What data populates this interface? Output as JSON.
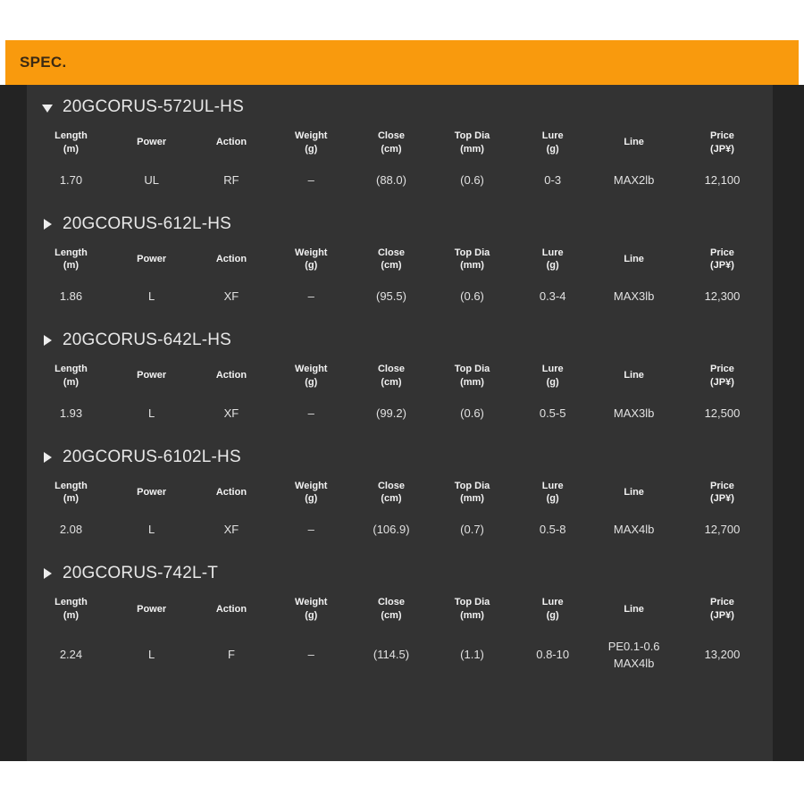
{
  "header": {
    "title": "SPEC.",
    "background_color": "#f99a0d",
    "text_color": "#3c2a13"
  },
  "panel": {
    "background_color": "#333333",
    "outer_background_color": "#232323"
  },
  "columns": [
    {
      "label": "Length",
      "unit": "(m)"
    },
    {
      "label": "Power",
      "unit": ""
    },
    {
      "label": "Action",
      "unit": ""
    },
    {
      "label": "Weight",
      "unit": "(g)"
    },
    {
      "label": "Close",
      "unit": "(cm)"
    },
    {
      "label": "Top Dia",
      "unit": "(mm)"
    },
    {
      "label": "Lure",
      "unit": "(g)"
    },
    {
      "label": "Line",
      "unit": ""
    },
    {
      "label": "Price",
      "unit": "(JP¥)"
    }
  ],
  "sections": [
    {
      "title": "20GCORUS-572UL-HS",
      "expanded": true,
      "toggle_icon": "triangle-down-icon",
      "row": {
        "length": "1.70",
        "power": "UL",
        "action": "RF",
        "weight": "–",
        "close": "(88.0)",
        "top_dia": "(0.6)",
        "lure": "0-3",
        "line": "MAX2lb",
        "price": "12,100"
      }
    },
    {
      "title": "20GCORUS-612L-HS",
      "expanded": false,
      "toggle_icon": "triangle-right-icon",
      "row": {
        "length": "1.86",
        "power": "L",
        "action": "XF",
        "weight": "–",
        "close": "(95.5)",
        "top_dia": "(0.6)",
        "lure": "0.3-4",
        "line": "MAX3lb",
        "price": "12,300"
      }
    },
    {
      "title": "20GCORUS-642L-HS",
      "expanded": false,
      "toggle_icon": "triangle-right-icon",
      "row": {
        "length": "1.93",
        "power": "L",
        "action": "XF",
        "weight": "–",
        "close": "(99.2)",
        "top_dia": "(0.6)",
        "lure": "0.5-5",
        "line": "MAX3lb",
        "price": "12,500"
      }
    },
    {
      "title": "20GCORUS-6102L-HS",
      "expanded": false,
      "toggle_icon": "triangle-right-icon",
      "row": {
        "length": "2.08",
        "power": "L",
        "action": "XF",
        "weight": "–",
        "close": "(106.9)",
        "top_dia": "(0.7)",
        "lure": "0.5-8",
        "line": "MAX4lb",
        "price": "12,700"
      }
    },
    {
      "title": "20GCORUS-742L-T",
      "expanded": false,
      "toggle_icon": "triangle-right-icon",
      "row": {
        "length": "2.24",
        "power": "L",
        "action": "F",
        "weight": "–",
        "close": "(114.5)",
        "top_dia": "(1.1)",
        "lure": "0.8-10",
        "line": "PE0.1-0.6",
        "line2": "MAX4lb",
        "price": "13,200"
      }
    }
  ]
}
